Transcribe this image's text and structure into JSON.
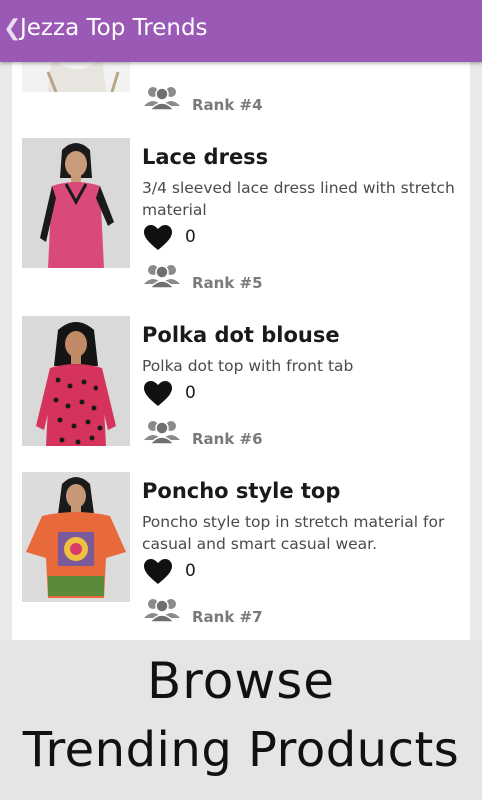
{
  "appbar": {
    "title": "Jezza Top Trends",
    "back_icon": "chevron-left-icon",
    "color": "#9b59b6"
  },
  "items": [
    {
      "rank": "Rank #4"
    },
    {
      "title": "Lace dress",
      "description": "3/4 sleeved lace dress lined with stretch material",
      "likes": "0",
      "rank": "Rank #5"
    },
    {
      "title": "Polka dot blouse",
      "description": "Polka dot top with front tab",
      "likes": "0",
      "rank": "Rank #6"
    },
    {
      "title": "Poncho style top",
      "description": "Poncho style top in stretch material for casual and smart casual wear.",
      "likes": "0",
      "rank": "Rank #7"
    }
  ],
  "banner": {
    "line1": "Browse",
    "line2": "Trending Products"
  }
}
